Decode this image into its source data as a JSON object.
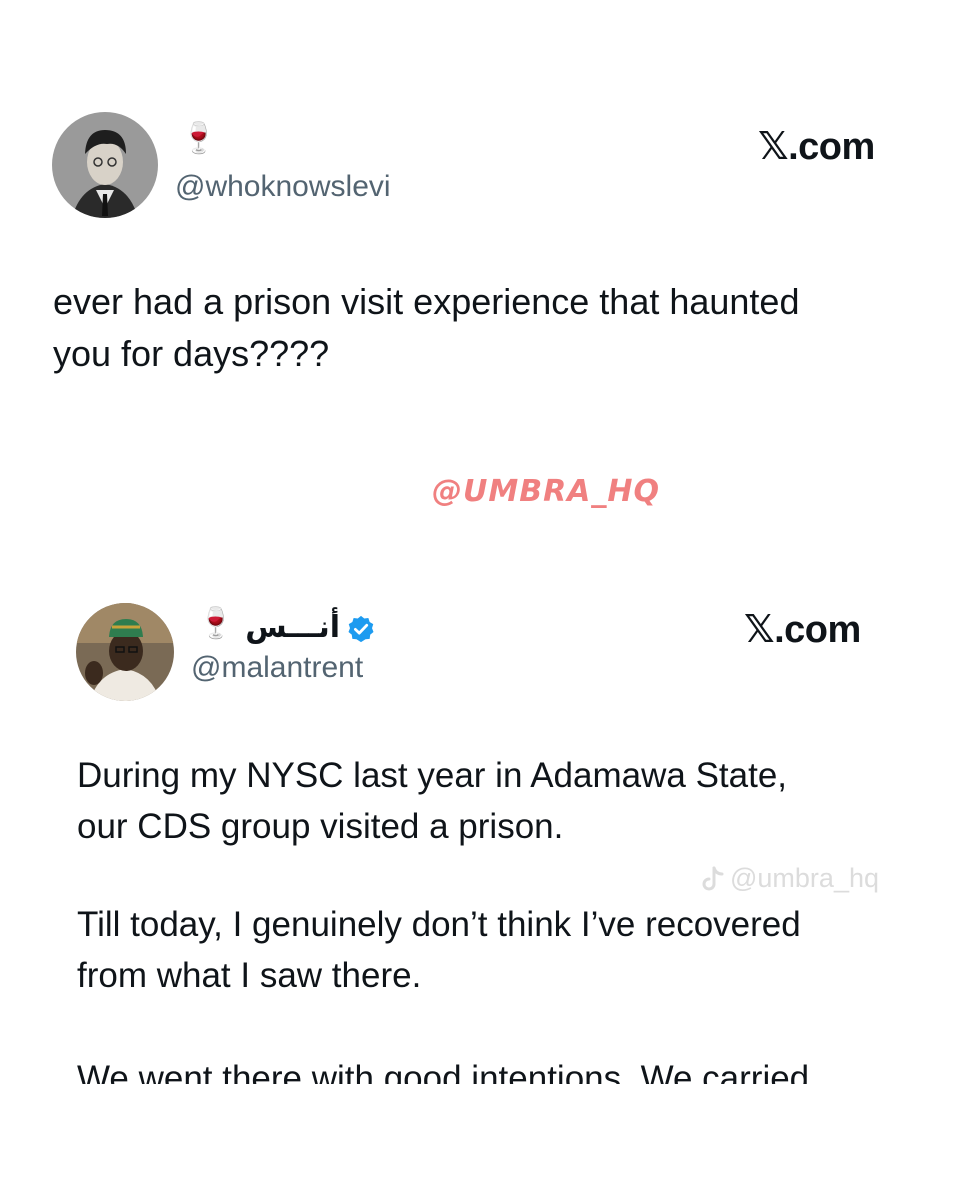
{
  "post1": {
    "name_emoji": "🍷",
    "handle": "@whoknowslevi",
    "brand": "𝕏.com",
    "text_lines": [
      "ever had a prison visit experience that haunted",
      "you for days????"
    ]
  },
  "tag": "@UMBRA_HQ",
  "post2": {
    "name": "أنـــس",
    "name_emoji": "🍷",
    "verified_icon": "verified-badge-icon",
    "handle": "@malantrent",
    "brand": "𝕏.com",
    "para1": [
      "During my NYSC last year in Adamawa State,",
      "our CDS group visited a prison."
    ],
    "para2": [
      "Till today, I genuinely don’t think I’ve recovered",
      "from what I saw there."
    ],
    "para3": [
      "We went there with good intentions. We carried"
    ]
  },
  "watermark": "@umbra_hq",
  "colors": {
    "handle": "#536471",
    "verified": "#1d9bf0",
    "tag": "#f08080"
  }
}
